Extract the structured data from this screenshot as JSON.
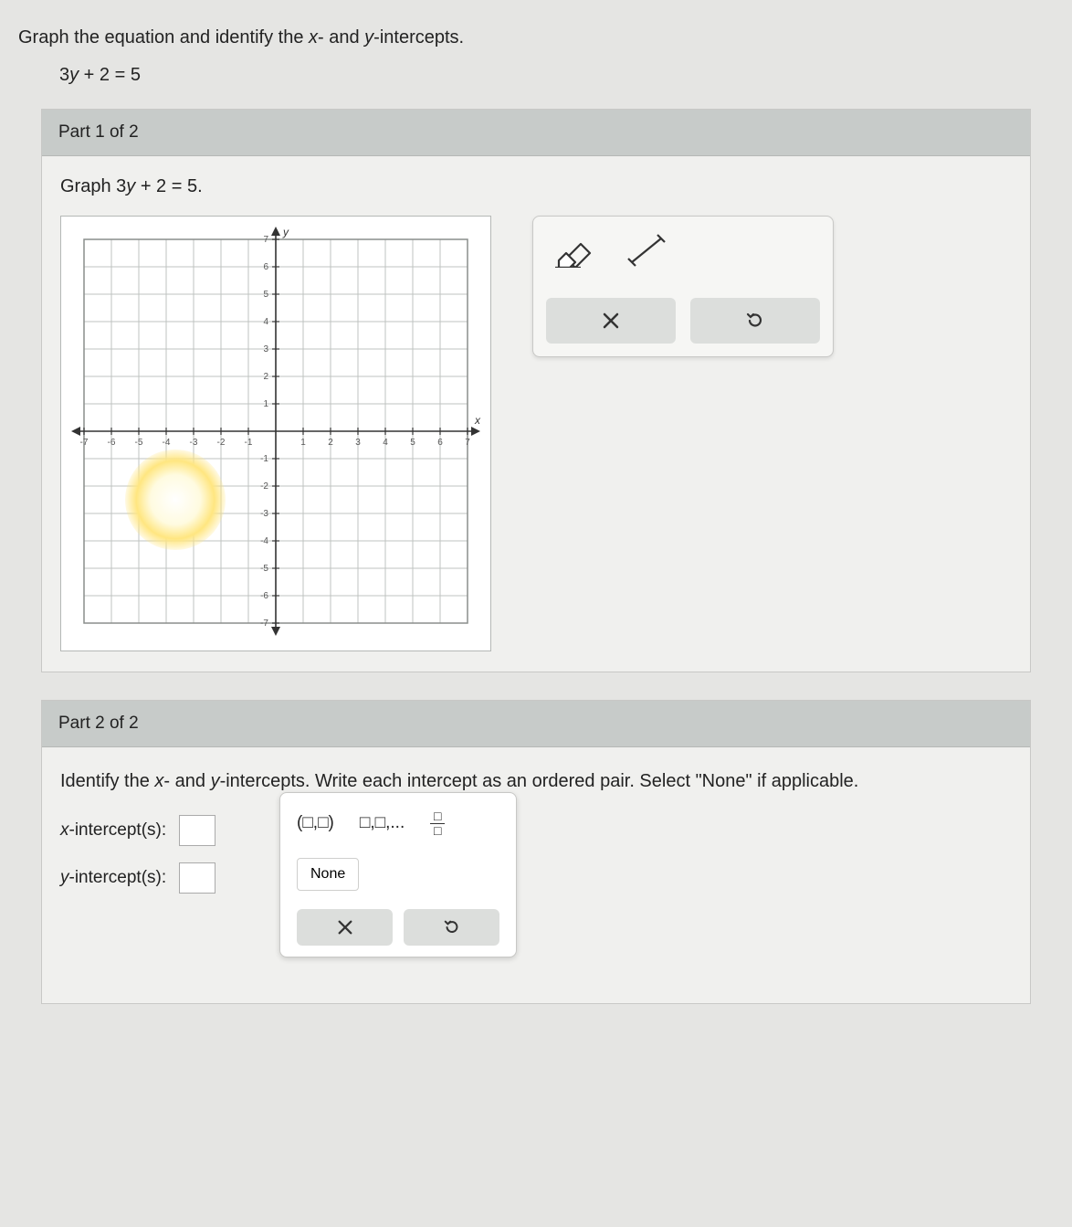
{
  "instruction": "Graph the equation and identify the x- and y-intercepts.",
  "equation_text": "3y + 2 = 5",
  "part1": {
    "header": "Part 1 of 2",
    "prompt": "Graph 3y + 2 = 5.",
    "tools": {
      "eraser": "eraser",
      "line": "line-segment",
      "clear_label": "×",
      "undo_label": "↺"
    }
  },
  "chart_data": {
    "type": "scatter",
    "title": "",
    "xlabel": "x",
    "ylabel": "y",
    "xlim": [
      -7,
      7
    ],
    "ylim": [
      -7,
      7
    ],
    "xticks": [
      -7,
      -6,
      -5,
      -4,
      -3,
      -2,
      -1,
      0,
      1,
      2,
      3,
      4,
      5,
      6,
      7
    ],
    "yticks": [
      -7,
      -6,
      -5,
      -4,
      -3,
      -2,
      -1,
      0,
      1,
      2,
      3,
      4,
      5,
      6,
      7
    ],
    "grid": true,
    "series": []
  },
  "part2": {
    "header": "Part 2 of 2",
    "prompt": "Identify the x- and y-intercepts. Write each intercept as an ordered pair. Select \"None\" if applicable.",
    "x_label": "x-intercept(s):",
    "y_label": "y-intercept(s):",
    "panel": {
      "ordered_pair": "(□,□)",
      "list": "□,□,...",
      "fraction_top": "□",
      "fraction_bot": "□",
      "none_label": "None",
      "clear_label": "×",
      "undo_label": "↺"
    }
  }
}
